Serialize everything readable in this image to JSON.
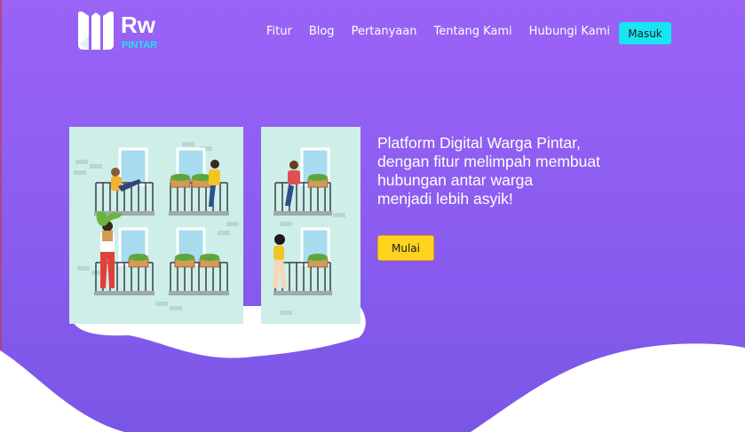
{
  "brand": {
    "logo_main": "Rw",
    "logo_sub": "PINTAR"
  },
  "nav": {
    "items": [
      {
        "label": "Fitur"
      },
      {
        "label": "Blog"
      },
      {
        "label": "Pertanyaan"
      },
      {
        "label": "Tentang Kami"
      },
      {
        "label": "Hubungi Kami"
      }
    ],
    "login_label": "Masuk"
  },
  "hero": {
    "lines": [
      "Platform Digital Warga Pintar,",
      "dengan fitur melimpah membuat",
      "hubungan antar warga",
      "menjadi lebih asyik!"
    ],
    "cta_label": "Mulai"
  },
  "colors": {
    "hero_bg": "#9a63f6",
    "login_btn": "#17e6f2",
    "cta_btn": "#ffd21e",
    "logo_accent": "#17e6f2"
  }
}
